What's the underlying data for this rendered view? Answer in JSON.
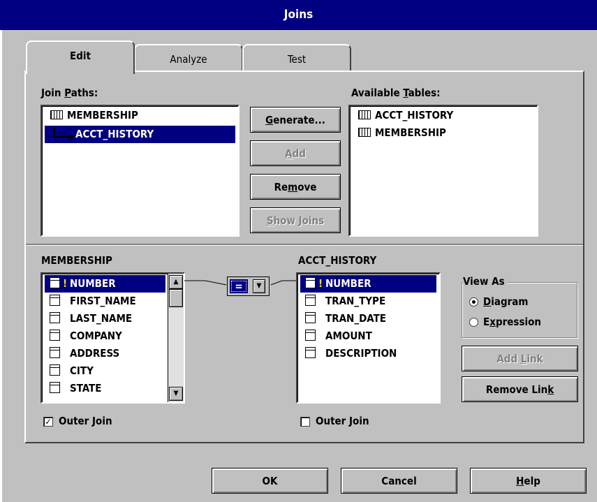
{
  "window": {
    "title": "Joins"
  },
  "tabs": [
    {
      "label": "Edit",
      "active": true
    },
    {
      "label": "Analyze",
      "active": false
    },
    {
      "label": "Test",
      "active": false
    }
  ],
  "join_paths": {
    "label_pre": "Join ",
    "label_u": "P",
    "label_post": "aths:",
    "items": [
      {
        "name": "MEMBERSHIP",
        "selected": false
      },
      {
        "name": "ACCT_HISTORY",
        "selected": true
      }
    ]
  },
  "available_tables": {
    "label_pre": "Available ",
    "label_u": "T",
    "label_post": "ables:",
    "items": [
      "ACCT_HISTORY",
      "MEMBERSHIP"
    ]
  },
  "buttons": {
    "generate": {
      "pre": "",
      "u": "G",
      "post": "enerate...",
      "enabled": true
    },
    "add": {
      "pre": "",
      "u": "A",
      "post": "dd",
      "enabled": false
    },
    "remove": {
      "pre": "Re",
      "u": "m",
      "post": "ove",
      "enabled": true
    },
    "show_joins": {
      "pre": "",
      "u": "S",
      "post": "how Joins",
      "enabled": false
    },
    "add_link": {
      "pre": "Add ",
      "u": "L",
      "post": "ink",
      "enabled": false
    },
    "remove_link": {
      "pre": "Remove Lin",
      "u": "k",
      "post": "",
      "enabled": true
    },
    "ok": {
      "label": "OK"
    },
    "cancel": {
      "label": "Cancel"
    },
    "help": {
      "pre": "",
      "u": "H",
      "post": "elp"
    }
  },
  "left_table": {
    "name": "MEMBERSHIP",
    "columns": [
      "NUMBER",
      "FIRST_NAME",
      "LAST_NAME",
      "COMPANY",
      "ADDRESS",
      "CITY",
      "STATE"
    ],
    "outer_join_label": "Outer Join",
    "outer_join_checked": true
  },
  "right_table": {
    "name": "ACCT_HISTORY",
    "columns": [
      "NUMBER",
      "TRAN_TYPE",
      "TRAN_DATE",
      "AMOUNT",
      "DESCRIPTION"
    ],
    "outer_join_label": "Outer Join",
    "outer_join_checked": false
  },
  "operator": {
    "value": "="
  },
  "view_as": {
    "label": "View As",
    "options": [
      {
        "pre": "",
        "u": "D",
        "post": "iagram",
        "checked": true
      },
      {
        "pre": "E",
        "u": "x",
        "post": "pression",
        "checked": false
      }
    ]
  },
  "colors": {
    "title_bar": "#000080",
    "selection": "#000080",
    "key": "#ffd700",
    "face": "#c0c0c0"
  }
}
